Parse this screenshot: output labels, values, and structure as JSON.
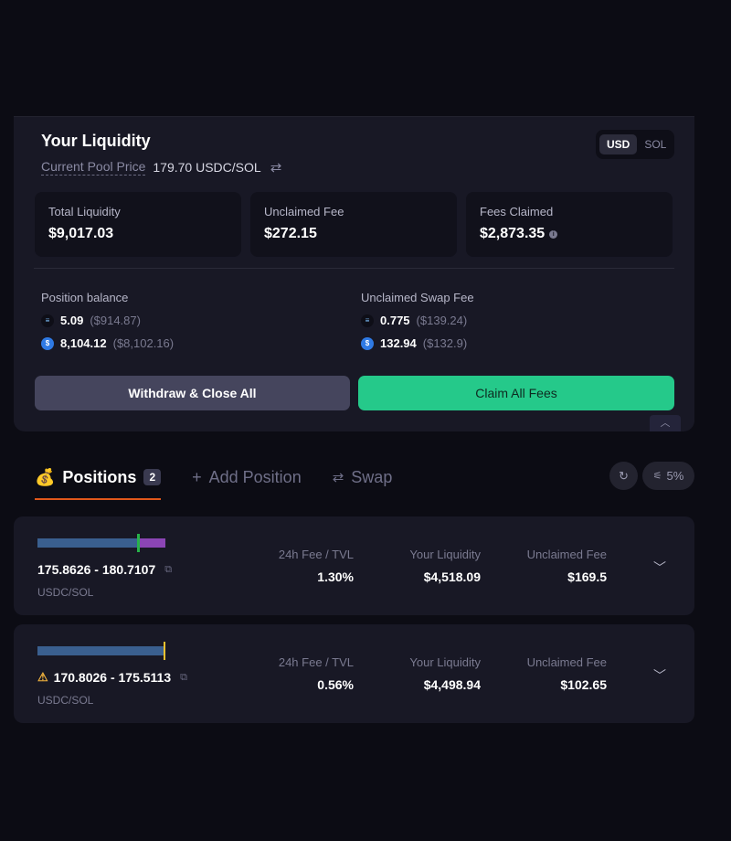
{
  "liquidity": {
    "title": "Your Liquidity",
    "pool_price_label": "Current Pool Price",
    "pool_price_value": "179.70 USDC/SOL",
    "currency_toggle": [
      "USD",
      "SOL"
    ],
    "active_currency": "USD",
    "stats": [
      {
        "label": "Total Liquidity",
        "value": "$9,017.03"
      },
      {
        "label": "Unclaimed Fee",
        "value": "$272.15"
      },
      {
        "label": "Fees Claimed",
        "value": "$2,873.35"
      }
    ],
    "position_balance": {
      "label": "Position balance",
      "rows": [
        {
          "token": "SOL",
          "amount": "5.09",
          "usd": "($914.87)"
        },
        {
          "token": "USDC",
          "amount": "8,104.12",
          "usd": "($8,102.16)"
        }
      ]
    },
    "unclaimed_swap_fee": {
      "label": "Unclaimed Swap Fee",
      "rows": [
        {
          "token": "SOL",
          "amount": "0.775",
          "usd": "($139.24)"
        },
        {
          "token": "USDC",
          "amount": "132.94",
          "usd": "($132.9)"
        }
      ]
    },
    "withdraw_label": "Withdraw & Close All",
    "claim_label": "Claim All Fees"
  },
  "tabs": {
    "positions": "Positions",
    "positions_count": "2",
    "add_position": "Add Position",
    "swap": "Swap"
  },
  "slippage": "5%",
  "columns": {
    "fee_tvl": "24h Fee / TVL",
    "your_liquidity": "Your Liquidity",
    "unclaimed_fee": "Unclaimed Fee"
  },
  "positions": [
    {
      "range": "175.8626 - 180.7107",
      "pair": "USDC/SOL",
      "fee_tvl": "1.30%",
      "your_liquidity": "$4,518.09",
      "unclaimed_fee": "$169.5",
      "warning": false,
      "bar_split": 0.79,
      "bar_price": 0.79
    },
    {
      "range": "170.8026 - 175.5113",
      "pair": "USDC/SOL",
      "fee_tvl": "0.56%",
      "your_liquidity": "$4,498.94",
      "unclaimed_fee": "$102.65",
      "warning": true,
      "bar_split": 1.0,
      "bar_price": 1.0
    }
  ],
  "colors": {
    "accent": "#25c98a",
    "tab_underline": "#e0571b",
    "bar_usdc": "#3a5f8f",
    "bar_sol": "#8b45b5",
    "price_in_range": "#27b24a",
    "price_out_range": "#f2c12e"
  },
  "icons": {
    "swap_price": "swap-arrows-icon",
    "positions": "money-bag-icon",
    "add": "plus-icon",
    "swap": "swap-icon",
    "refresh": "refresh-icon",
    "slippage": "sliders-icon",
    "external": "external-link-icon",
    "warning": "warning-icon",
    "expand": "chevron-down-icon",
    "collapse": "chevron-up-icon"
  }
}
